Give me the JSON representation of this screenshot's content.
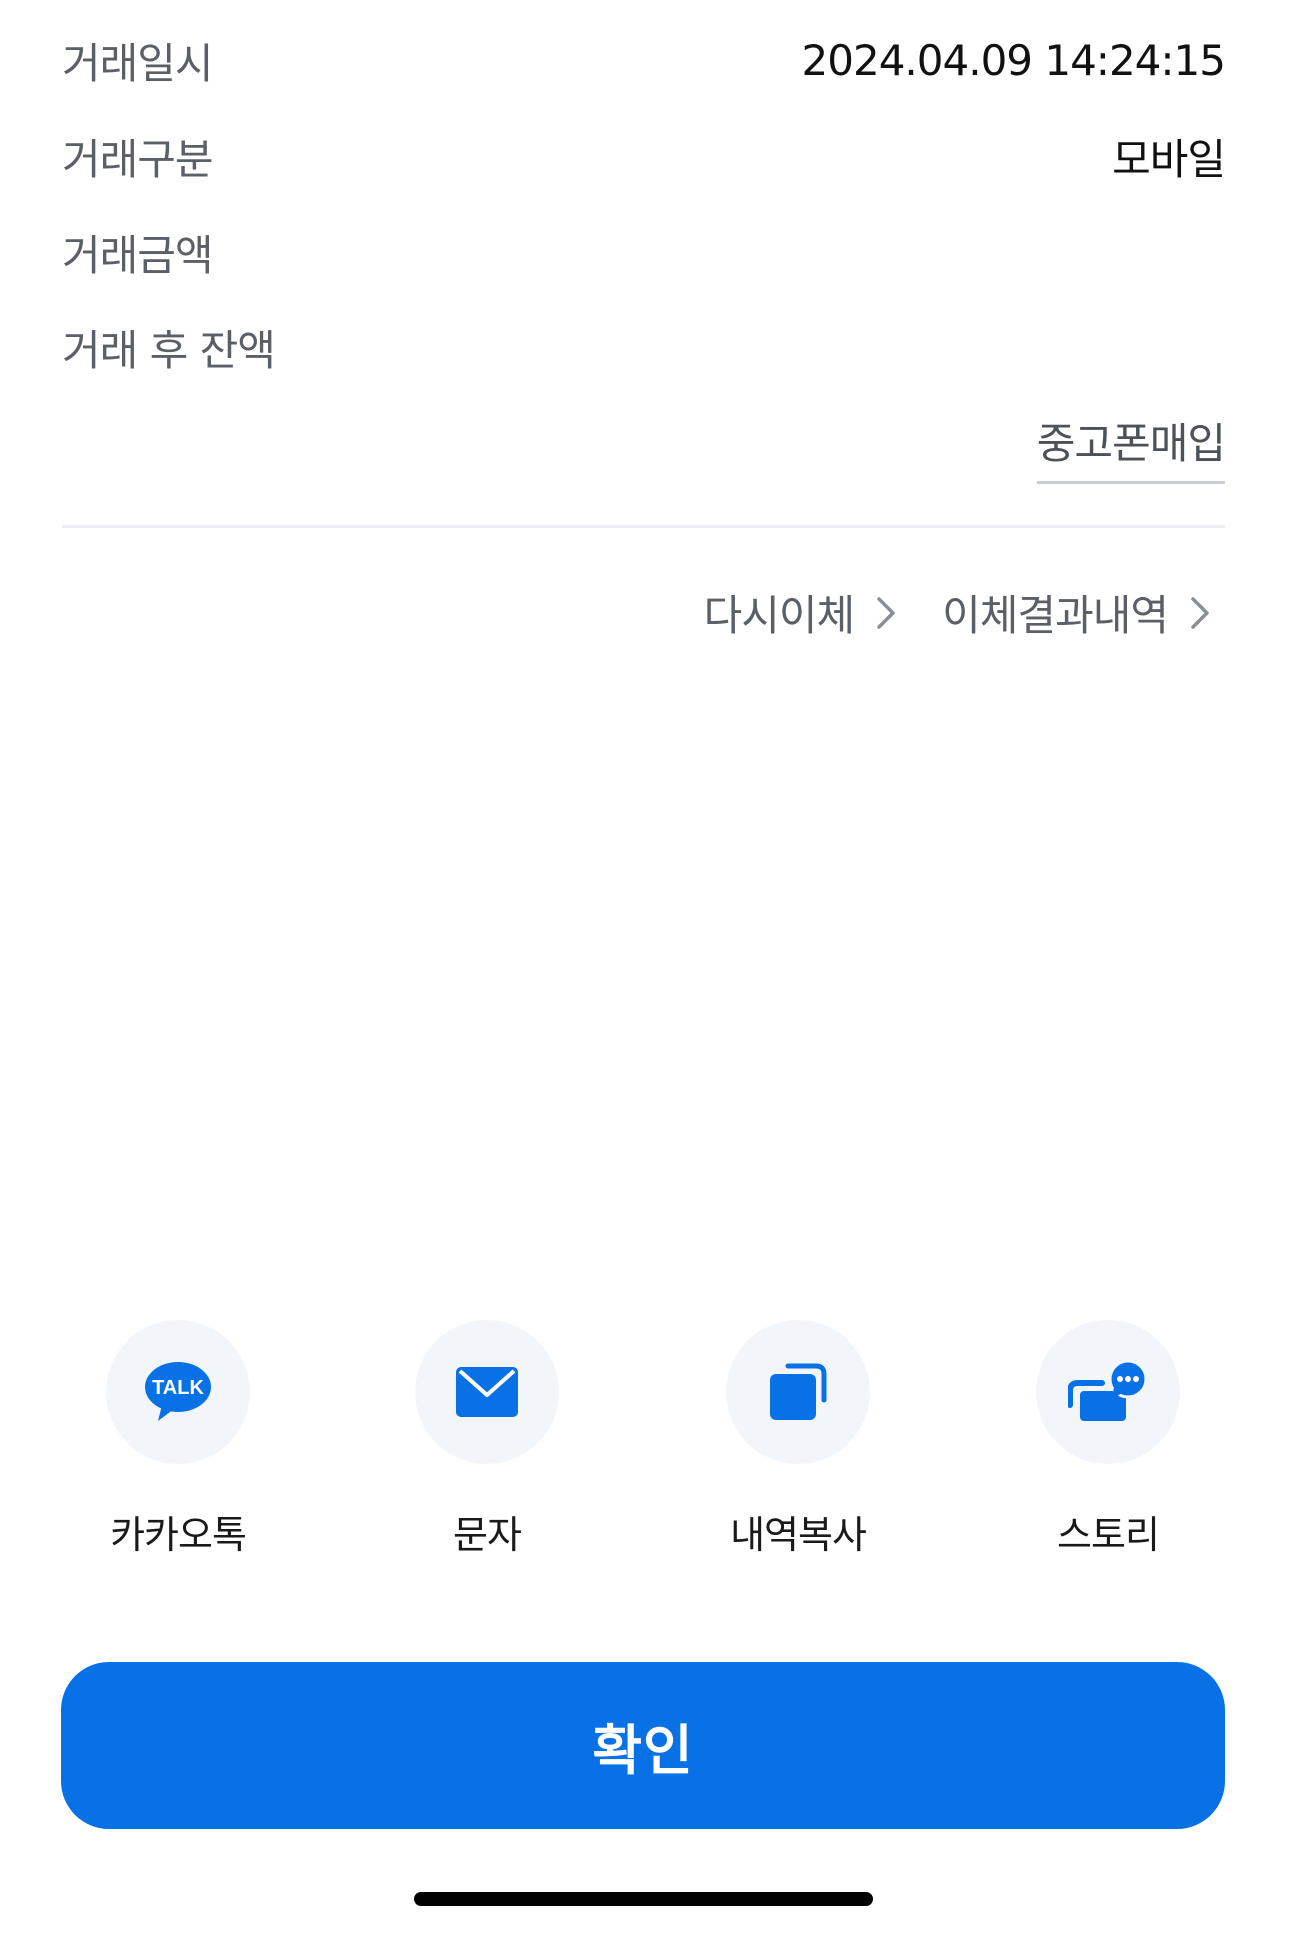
{
  "details": [
    {
      "label": "거래일시",
      "value": "2024.04.09 14:24:15"
    },
    {
      "label": "거래구분",
      "value": "모바일"
    },
    {
      "label": "거래금액",
      "value": ""
    },
    {
      "label": "거래 후 잔액",
      "value": ""
    }
  ],
  "promo_link": "중고폰매입",
  "links": {
    "retransfer": "다시이체",
    "transfer_history": "이체결과내역"
  },
  "share": [
    {
      "label": "카카오톡",
      "icon": "kakaotalk-icon",
      "icon_text": "TALK"
    },
    {
      "label": "문자",
      "icon": "message-icon"
    },
    {
      "label": "내역복사",
      "icon": "copy-icon"
    },
    {
      "label": "스토리",
      "icon": "story-icon"
    }
  ],
  "confirm_label": "확인",
  "colors": {
    "accent": "#0871e6",
    "icon_bg": "#f2f5fa"
  }
}
